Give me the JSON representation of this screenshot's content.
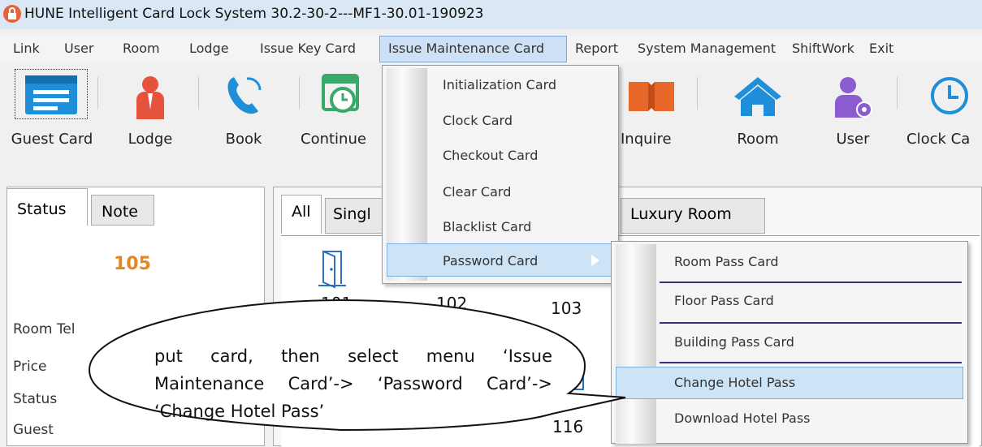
{
  "window": {
    "title": "HUNE Intelligent Card Lock System 30.2-30-2---MF1-30.01-190923"
  },
  "menubar": {
    "items": [
      "Link",
      "User",
      "Room",
      "Lodge",
      "Issue Key Card",
      "Issue Maintenance Card",
      "Report",
      "System Management",
      "ShiftWork",
      "Exit"
    ]
  },
  "toolbar": {
    "guest_card": "Guest Card",
    "lodge": "Lodge",
    "book": "Book",
    "continue": "Continue",
    "inquire": "Inquire",
    "room": "Room",
    "user": "User",
    "clock_card": "Clock Ca"
  },
  "status_panel": {
    "tab_status": "Status",
    "tab_note": "Note",
    "room_number": "105",
    "room_tel": "Room Tel",
    "price": "Price",
    "status": "Status",
    "guest": "Guest"
  },
  "rooms": {
    "tab_all": "All",
    "tab_single": "Singl",
    "tab_luxury": "Luxury Room",
    "numbers": [
      "101",
      "102",
      "103",
      "116"
    ]
  },
  "dropdown1": {
    "items": [
      "Initialization Card",
      "Clock Card",
      "Checkout Card",
      "Clear Card",
      "Blacklist Card",
      "Password Card"
    ]
  },
  "dropdown2": {
    "items": [
      "Room Pass Card",
      "Floor Pass Card",
      "Building Pass Card",
      "Change Hotel Pass",
      "Download Hotel Pass"
    ]
  },
  "callout": {
    "text": "put card, then select menu ‘Issue Maintenance Card’-> ‘Password Card’-> ‘Change Hotel Pass’"
  },
  "colors": {
    "menu_highlight": "#cde0f5",
    "accent_orange": "#e8861f",
    "icon_blue": "#1e8fd8",
    "icon_red": "#e5533d",
    "icon_purple": "#8a5cd0",
    "icon_green": "#3aa86a"
  }
}
